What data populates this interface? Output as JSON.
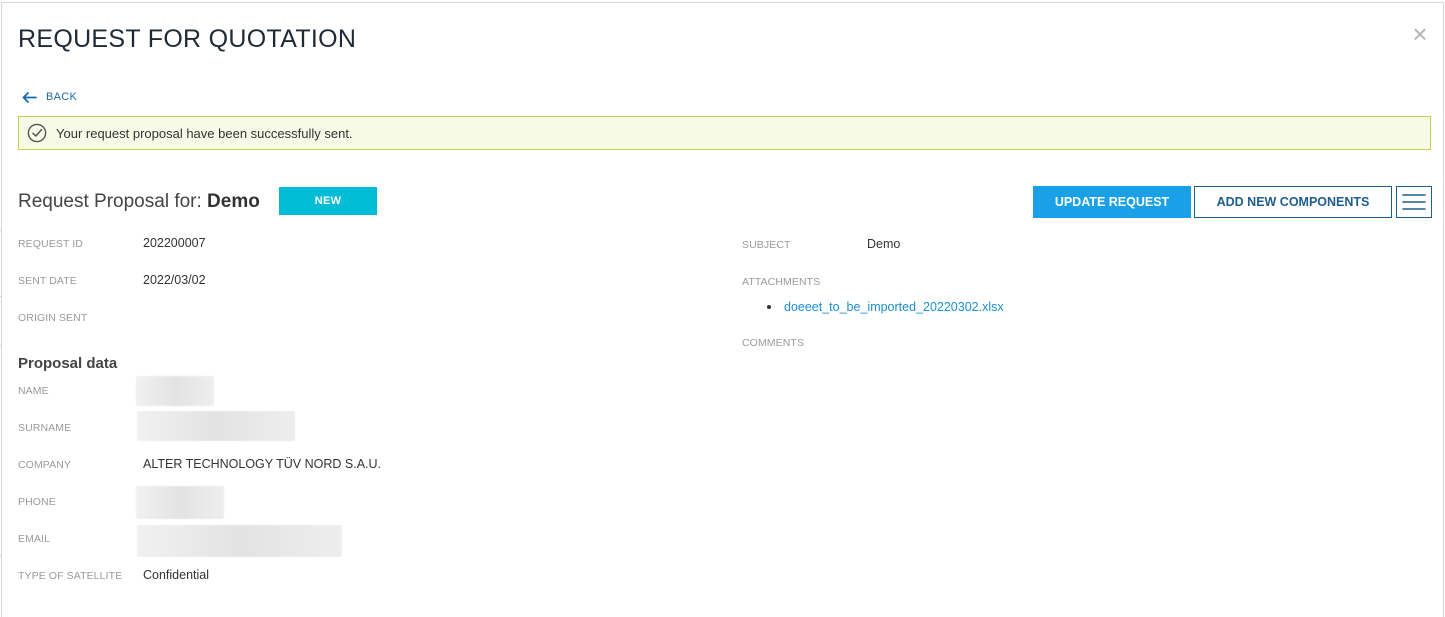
{
  "modal": {
    "title": "REQUEST FOR QUOTATION",
    "close_glyph": "×"
  },
  "back": {
    "label": "BACK"
  },
  "alert": {
    "message": "Your request proposal have been successfully sent."
  },
  "proposal": {
    "title_prefix": "Request Proposal for:",
    "title_name": "Demo",
    "status_badge": "NEW"
  },
  "actions": {
    "update_label": "UPDATE REQUEST",
    "add_components_label": "ADD NEW COMPONENTS"
  },
  "request_fields": {
    "request_id_label": "REQUEST ID",
    "request_id_value": "202200007",
    "sent_date_label": "SENT DATE",
    "sent_date_value": "2022/03/02",
    "origin_sent_label": "ORIGIN SENT"
  },
  "right_fields": {
    "subject_label": "SUBJECT",
    "subject_value": "Demo",
    "attachments_label": "ATTACHMENTS",
    "attachments": [
      "doeeet_to_be_imported_20220302.xlsx"
    ],
    "comments_label": "COMMENTS"
  },
  "proposal_data": {
    "section_title": "Proposal data",
    "name_label": "NAME",
    "surname_label": "SURNAME",
    "company_label": "COMPANY",
    "company_value": "ALTER TECHNOLOGY TÜV NORD S.A.U.",
    "phone_label": "PHONE",
    "email_label": "EMAIL",
    "satellite_label": "TYPE OF SATELLITE",
    "satellite_value": "Confidential"
  },
  "colors": {
    "primary_blue": "#1aa0e6",
    "outline_blue": "#1f5d8c",
    "badge_cyan": "#00bcd4",
    "alert_bg": "#f7fae6",
    "alert_border": "#c6d34a",
    "link_blue": "#1a8fd1"
  },
  "icons": {
    "back": "arrow-left-icon",
    "alert": "check-circle-icon",
    "menu": "hamburger-menu-icon",
    "close": "close-icon"
  }
}
